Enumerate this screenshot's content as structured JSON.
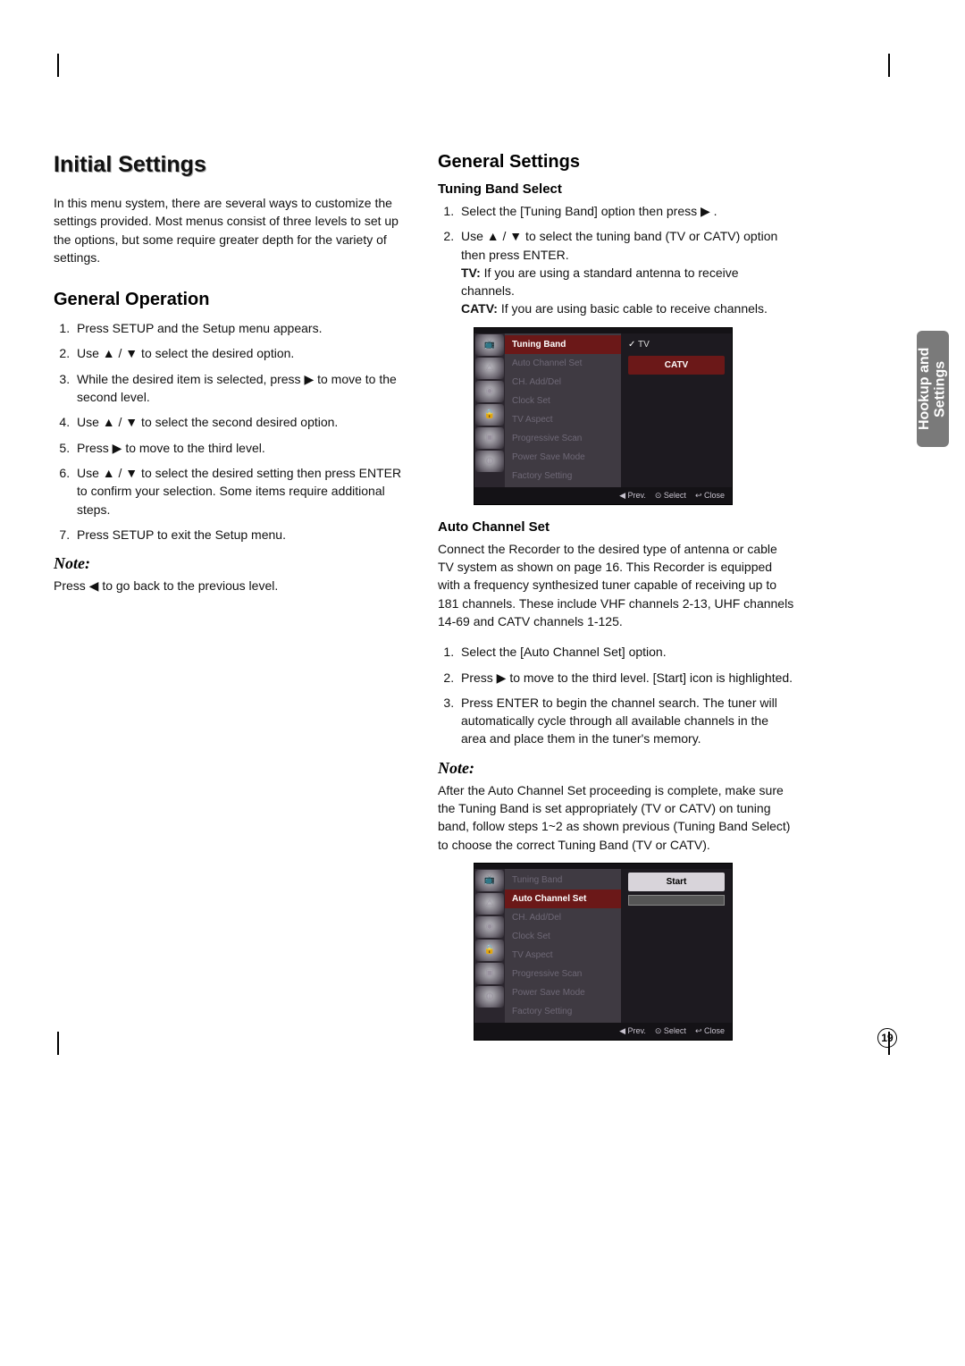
{
  "sideTab": "Hookup and Settings",
  "pageNumber": "19",
  "left": {
    "h1": "Initial Settings",
    "intro": "In this menu system, there are several ways to customize the settings provided. Most menus consist of three levels to set up the options, but some require greater depth for the variety of settings.",
    "h2": "General Operation",
    "steps": [
      "Press SETUP and the Setup menu appears.",
      "Use ▲ / ▼ to select the desired option.",
      "While the desired item is selected, press ▶ to move to the second level.",
      "Use ▲ / ▼ to select the second desired option.",
      "Press ▶ to move to the third level.",
      "Use ▲ / ▼ to select the desired setting then press ENTER to confirm your selection. Some items require additional steps.",
      "Press SETUP to exit the Setup menu."
    ],
    "noteH": "Note:",
    "noteText": "Press ◀ to go back to the previous level."
  },
  "right": {
    "h2": "General Settings",
    "tuning": {
      "h3": "Tuning Band Select",
      "steps": [
        "Select the [Tuning Band] option then press ▶ .",
        "Use ▲ / ▼ to select the tuning band (TV or CATV) option then press ENTER."
      ],
      "tvLabel": "TV:",
      "tvText": " If you are using a standard antenna to receive channels.",
      "catvLabel": "CATV:",
      "catvText": " If you are using basic cable to receive channels."
    },
    "auto": {
      "h3": "Auto Channel Set",
      "intro": "Connect the Recorder to the desired type of antenna or cable TV system as shown on page 16. This Recorder is equipped with a frequency synthesized tuner capable of receiving up to 181 channels. These include VHF channels 2-13, UHF channels 14-69 and CATV channels 1-125.",
      "steps": [
        "Select the [Auto Channel Set] option.",
        "Press ▶ to move to the third level. [Start] icon is highlighted.",
        "Press ENTER to begin the channel search. The tuner will automatically cycle through all available channels in the area and place them in the tuner's memory."
      ],
      "noteH": "Note:",
      "noteText": "After the Auto Channel Set proceeding is complete, make sure the Tuning Band is set appropriately (TV or CATV) on tuning band, follow steps 1~2 as shown previous (Tuning Band Select) to choose the correct Tuning Band (TV or CATV)."
    },
    "ui1": {
      "menu": [
        "Tuning Band",
        "Auto Channel Set",
        "CH. Add/Del",
        "Clock Set",
        "TV Aspect",
        "Progressive Scan",
        "Power Save Mode",
        "Factory Setting"
      ],
      "opts": [
        "TV",
        "CATV"
      ],
      "bar": [
        "◀ Prev.",
        "⊙ Select",
        "↩ Close"
      ]
    },
    "ui2": {
      "menu": [
        "Tuning Band",
        "Auto Channel Set",
        "CH. Add/Del",
        "Clock Set",
        "TV Aspect",
        "Progressive Scan",
        "Power Save Mode",
        "Factory Setting"
      ],
      "start": "Start",
      "bar": [
        "◀ Prev.",
        "⊙ Select",
        "↩ Close"
      ]
    }
  }
}
